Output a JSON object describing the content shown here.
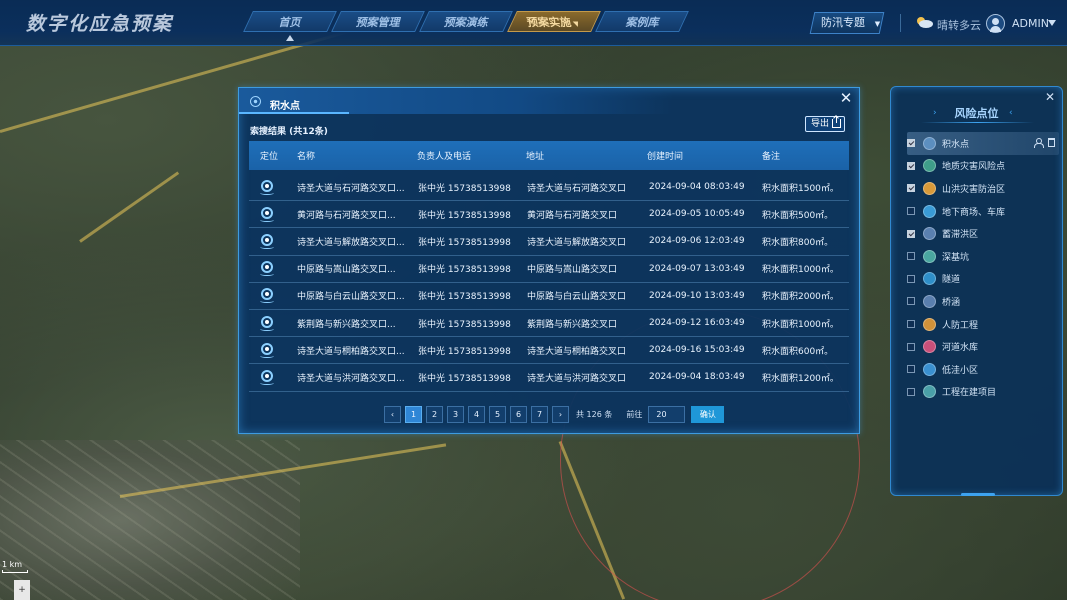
{
  "app": {
    "title": "数字化应急预案",
    "nav": [
      {
        "label": "首页",
        "active": false,
        "dropdown": false
      },
      {
        "label": "预案管理",
        "active": false,
        "dropdown": false
      },
      {
        "label": "预案演练",
        "active": false,
        "dropdown": false
      },
      {
        "label": "预案实施",
        "active": true,
        "dropdown": true
      },
      {
        "label": "案例库",
        "active": false,
        "dropdown": false
      }
    ],
    "topic_select": "防汛专题",
    "weather": {
      "icon": "partly-cloudy-icon",
      "text": "晴转多云"
    },
    "user": {
      "name": "ADMIN"
    }
  },
  "modal": {
    "title": "积水点",
    "result_summary": "索搜结果 (共12条)",
    "export_label": "导出",
    "columns": [
      "定位",
      "名称",
      "负责人及电话",
      "地址",
      "创建时间",
      "备注"
    ],
    "rows": [
      {
        "name": "诗圣大道与石河路交叉口...",
        "contact": "张中光 15738513998",
        "address": "诗圣大道与石河路交叉口",
        "created": "2024-09-04 08:03:49",
        "note": "积水面积1500㎡。"
      },
      {
        "name": "黄河路与石河路交叉口...",
        "contact": "张中光 15738513998",
        "address": "黄河路与石河路交叉口",
        "created": "2024-09-05 10:05:49",
        "note": "积水面积500㎡。"
      },
      {
        "name": "诗圣大道与解放路交叉口...",
        "contact": "张中光 15738513998",
        "address": "诗圣大道与解放路交叉口",
        "created": "2024-09-06 12:03:49",
        "note": "积水面积800㎡。"
      },
      {
        "name": "中原路与嵩山路交叉口...",
        "contact": "张中光 15738513998",
        "address": "中原路与嵩山路交叉口",
        "created": "2024-09-07 13:03:49",
        "note": "积水面积1000㎡。"
      },
      {
        "name": "中原路与白云山路交叉口...",
        "contact": "张中光 15738513998",
        "address": "中原路与白云山路交叉口",
        "created": "2024-09-10 13:03:49",
        "note": "积水面积2000㎡。"
      },
      {
        "name": "紫荆路与新兴路交叉口...",
        "contact": "张中光 15738513998",
        "address": "紫荆路与新兴路交叉口",
        "created": "2024-09-12 16:03:49",
        "note": "积水面积1000㎡。"
      },
      {
        "name": "诗圣大道与桐柏路交叉口...",
        "contact": "张中光 15738513998",
        "address": "诗圣大道与桐柏路交叉口",
        "created": "2024-09-16 15:03:49",
        "note": "积水面积600㎡。"
      },
      {
        "name": "诗圣大道与洪河路交叉口...",
        "contact": "张中光 15738513998",
        "address": "诗圣大道与洪河路交叉口",
        "created": "2024-09-04 18:03:49",
        "note": "积水面积1200㎡。"
      }
    ],
    "pagination": {
      "pages": [
        "1",
        "2",
        "3",
        "4",
        "5",
        "6",
        "7"
      ],
      "current": "1",
      "prev": "‹",
      "next": "›",
      "total": "共 126 条",
      "goto_label": "前往",
      "goto_value": "20",
      "confirm_label": "确认"
    }
  },
  "risk_panel": {
    "title": "风险点位",
    "items": [
      {
        "label": "积水点",
        "checked": true,
        "selected": true,
        "icon": "waterlogging-icon",
        "color": "#5c8fc0"
      },
      {
        "label": "地质灾害风险点",
        "checked": true,
        "selected": false,
        "icon": "geological-hazard-icon",
        "color": "#3f9e8a"
      },
      {
        "label": "山洪灾害防治区",
        "checked": true,
        "selected": false,
        "icon": "flash-flood-icon",
        "color": "#d99a3a"
      },
      {
        "label": "地下商场、车库",
        "checked": false,
        "selected": false,
        "icon": "underground-mall-icon",
        "color": "#3a9bd6"
      },
      {
        "label": "蓄滞洪区",
        "checked": true,
        "selected": false,
        "icon": "flood-storage-icon",
        "color": "#5a80b0"
      },
      {
        "label": "深基坑",
        "checked": false,
        "selected": false,
        "icon": "deep-pit-icon",
        "color": "#4aa7a0"
      },
      {
        "label": "隧道",
        "checked": false,
        "selected": false,
        "icon": "tunnel-icon",
        "color": "#2f8fc9"
      },
      {
        "label": "桥涵",
        "checked": false,
        "selected": false,
        "icon": "bridge-icon",
        "color": "#5a7fae"
      },
      {
        "label": "人防工程",
        "checked": false,
        "selected": false,
        "icon": "civil-defense-icon",
        "color": "#d1923a"
      },
      {
        "label": "河道水库",
        "checked": false,
        "selected": false,
        "icon": "river-reservoir-icon",
        "color": "#c9507a"
      },
      {
        "label": "低洼小区",
        "checked": false,
        "selected": false,
        "icon": "low-lying-community-icon",
        "color": "#3a90d0"
      },
      {
        "label": "工程在建项目",
        "checked": false,
        "selected": false,
        "icon": "construction-project-icon",
        "color": "#4aa0a8"
      }
    ]
  },
  "map": {
    "scale_text": "1 km"
  }
}
